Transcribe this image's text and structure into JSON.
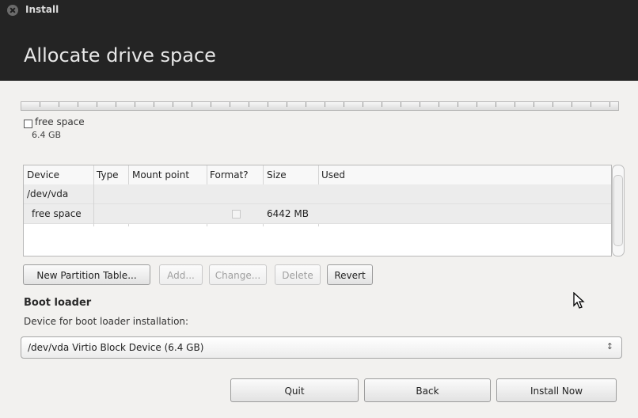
{
  "window": {
    "title": "Install"
  },
  "header": {
    "title": "Allocate drive space"
  },
  "partition_bar": {
    "label": "free space",
    "size": "6.4 GB"
  },
  "table": {
    "columns": [
      "Device",
      "Type",
      "Mount point",
      "Format?",
      "Size",
      "Used"
    ],
    "rows": [
      {
        "device": "/dev/vda",
        "type": "",
        "mount": "",
        "format": "",
        "size": "",
        "used": ""
      },
      {
        "device": "free space",
        "type": "",
        "mount": "",
        "format": false,
        "size": "6442 MB",
        "used": ""
      }
    ]
  },
  "partition_buttons": {
    "new_table": "New Partition Table...",
    "add": "Add...",
    "change": "Change...",
    "delete": "Delete",
    "revert": "Revert"
  },
  "boot_loader": {
    "title": "Boot loader",
    "description": "Device for boot loader installation:",
    "selected": "/dev/vda Virtio Block Device (6.4 GB)"
  },
  "footer": {
    "quit": "Quit",
    "back": "Back",
    "install": "Install Now"
  },
  "icons": {
    "close": "close-icon",
    "combo_arrow": "updown-chevron-icon",
    "cursor": "mouse-pointer-icon"
  }
}
